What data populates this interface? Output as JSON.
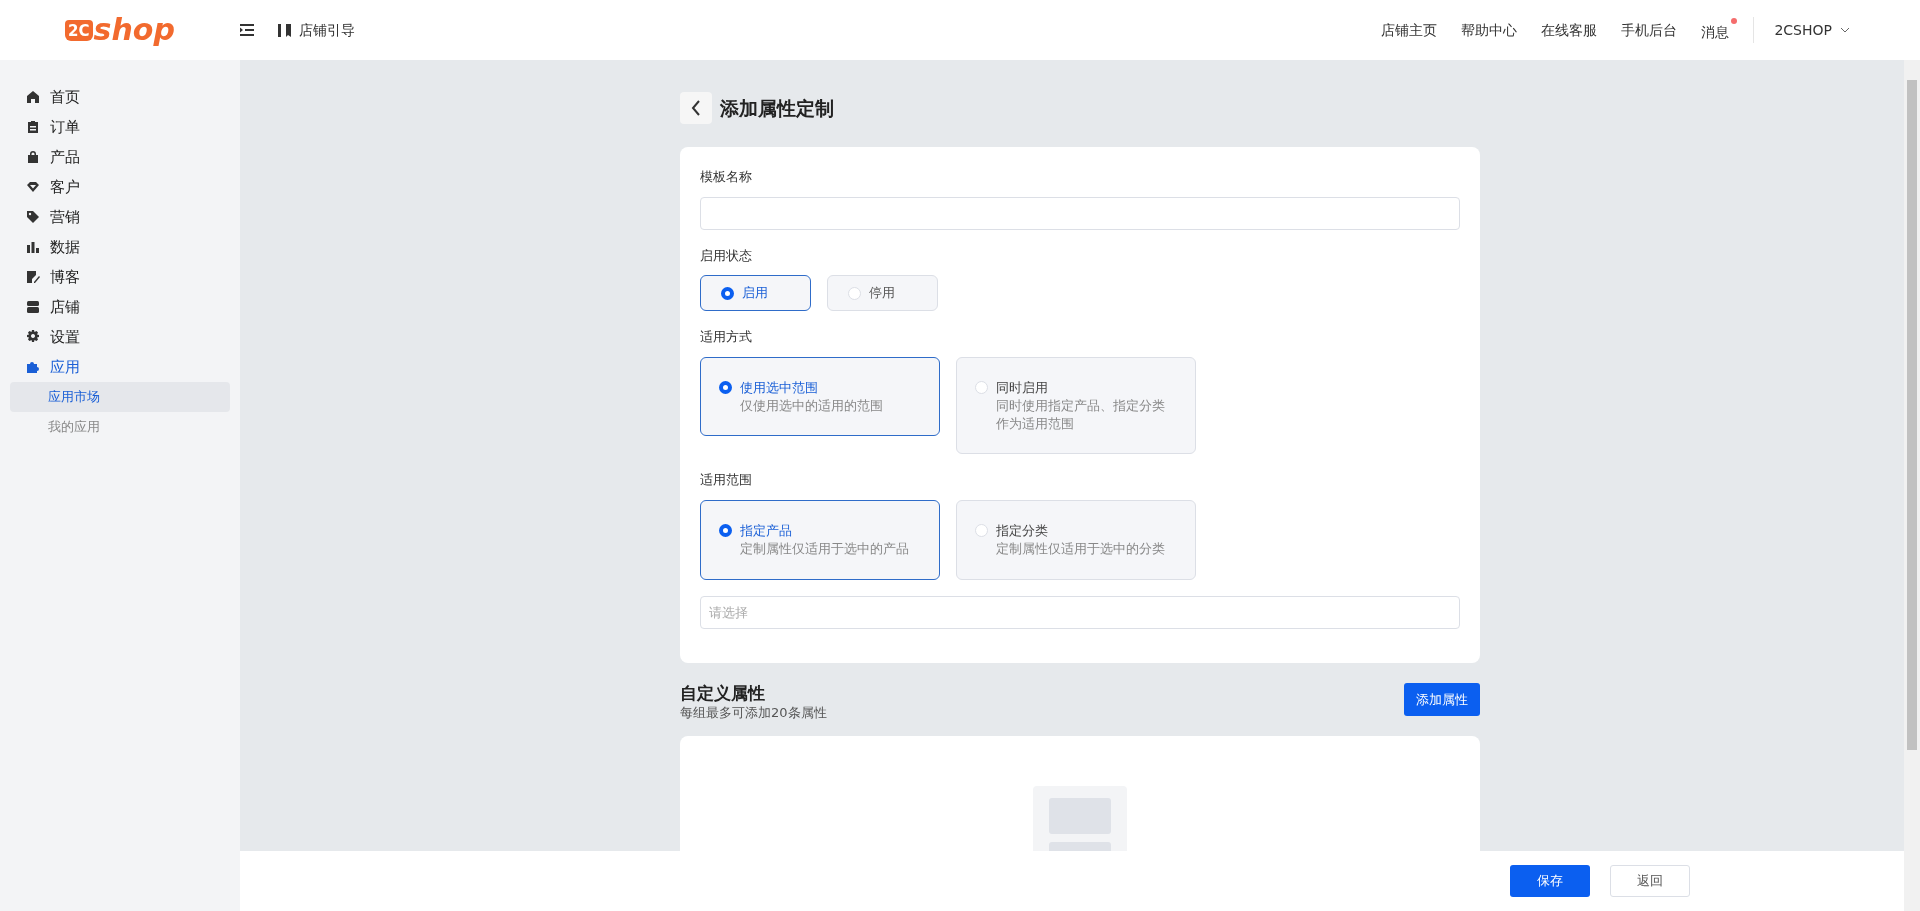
{
  "header": {
    "logo": {
      "mark": "2C",
      "text": "shop"
    },
    "guide": "店铺引导",
    "links": [
      {
        "label": "店铺主页",
        "badge": false
      },
      {
        "label": "帮助中心",
        "badge": false
      },
      {
        "label": "在线客服",
        "badge": false
      },
      {
        "label": "手机后台",
        "badge": false
      },
      {
        "label": "消息",
        "badge": true
      }
    ],
    "account": "2CSHOP"
  },
  "sidebar": {
    "items": [
      {
        "label": "首页",
        "selected": false
      },
      {
        "label": "订单",
        "selected": false
      },
      {
        "label": "产品",
        "selected": false
      },
      {
        "label": "客户",
        "selected": false
      },
      {
        "label": "营销",
        "selected": false
      },
      {
        "label": "数据",
        "selected": false
      },
      {
        "label": "博客",
        "selected": false
      },
      {
        "label": "店铺",
        "selected": false
      },
      {
        "label": "设置",
        "selected": false
      },
      {
        "label": "应用",
        "selected": true,
        "expanded": true,
        "children": [
          {
            "label": "应用市场",
            "selected": true
          },
          {
            "label": "我的应用",
            "selected": false
          }
        ]
      }
    ]
  },
  "page": {
    "title": "添加属性定制"
  },
  "form": {
    "name": {
      "label": "模板名称"
    },
    "status": {
      "label": "启用状态",
      "options": [
        {
          "label": "启用",
          "selected": true
        },
        {
          "label": "停用",
          "selected": false
        }
      ]
    },
    "method": {
      "label": "适用方式",
      "options": [
        {
          "title": "使用选中范围",
          "description": "仅使用选中的适用的范围",
          "selected": true
        },
        {
          "title": "同时启用",
          "description": "同时使用指定产品、指定分类作为适用范围",
          "selected": false
        }
      ]
    },
    "scope": {
      "label": "适用范围",
      "options": [
        {
          "title": "指定产品",
          "description": "定制属性仅适用于选中的产品",
          "selected": true
        },
        {
          "title": "指定分类",
          "description": "定制属性仅适用于选中的分类",
          "selected": false
        }
      ],
      "select": {
        "placeholder": "请选择"
      }
    }
  },
  "custom": {
    "title": "自定义属性",
    "subtitle": "每组最多可添加20条属性",
    "button": "添加属性"
  },
  "footer": {
    "buttons": [
      {
        "label": "保存",
        "kind": "primary"
      },
      {
        "label": "返回",
        "kind": "secondary"
      }
    ]
  }
}
